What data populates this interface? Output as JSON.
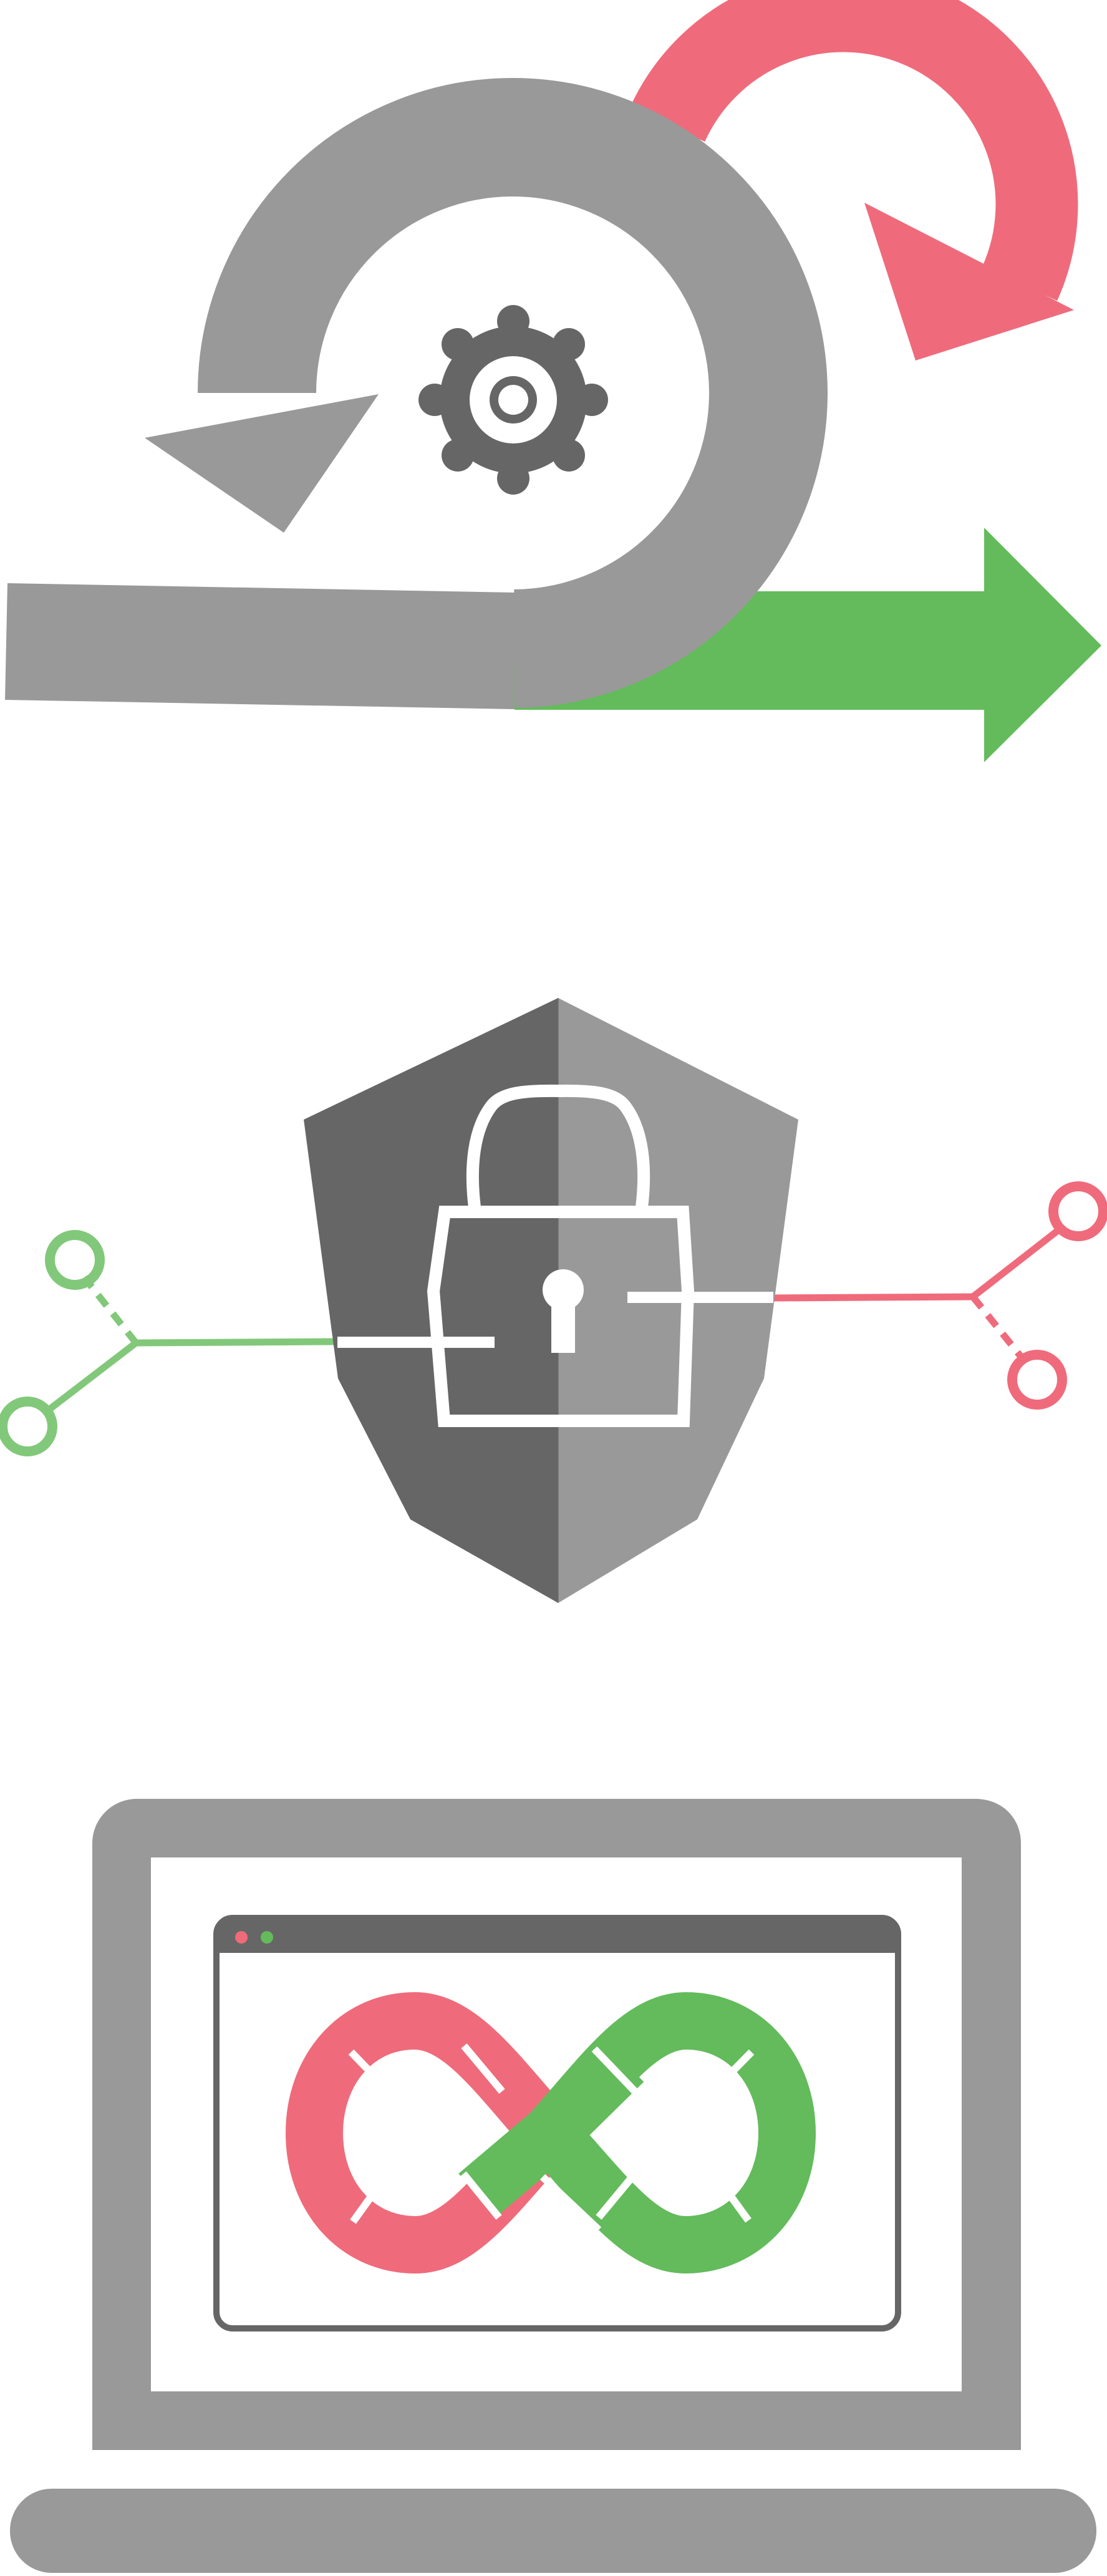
{
  "illustrations": [
    {
      "id": "agile-cycle",
      "icon": "agile-cycle-arrows-icon"
    },
    {
      "id": "secure-connection",
      "icon": "shield-padlock-icon"
    },
    {
      "id": "devops-infinity",
      "icon": "laptop-infinity-loop-icon"
    }
  ],
  "colors": {
    "gray": "#999999",
    "dark_gray": "#666666",
    "red": "#ef6b7b",
    "green": "#63bb5b",
    "light_green": "#82c87a",
    "white": "#ffffff"
  }
}
